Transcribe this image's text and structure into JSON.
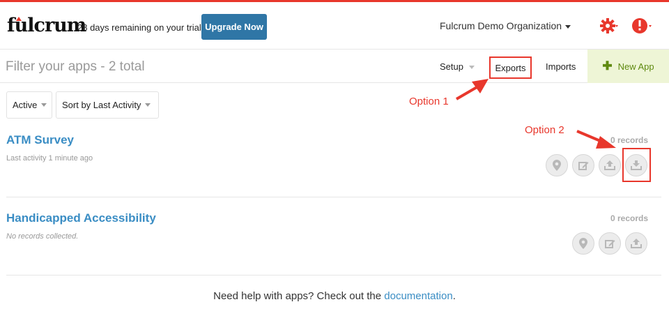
{
  "header": {
    "logo_text": "fulcrum",
    "trial_text": "28 days remaining on your trial",
    "upgrade_label": "Upgrade Now",
    "organization": "Fulcrum Demo Organization",
    "icons": {
      "settings": "gear-icon",
      "info": "info-icon"
    },
    "accent_color": "#e8372c",
    "button_color": "#2f76a6"
  },
  "filterbar": {
    "placeholder": "Filter your apps - 2 total",
    "setup_label": "Setup",
    "exports_label": "Exports",
    "imports_label": "Imports",
    "new_app_label": "New App"
  },
  "filters": {
    "status_selected": "Active",
    "sort_selected": "Sort by Last Activity"
  },
  "annotations": {
    "option1": "Option 1",
    "option2": "Option 2"
  },
  "apps": [
    {
      "name": "ATM Survey",
      "subtitle": "Last activity 1 minute ago",
      "records": "0 records",
      "actions": [
        "map-pin-icon",
        "edit-icon",
        "upload-icon",
        "download-icon"
      ]
    },
    {
      "name": "Handicapped Accessibility",
      "subtitle": "No records collected.",
      "records": "0 records",
      "actions": [
        "map-pin-icon",
        "edit-icon",
        "upload-icon"
      ]
    }
  ],
  "footer": {
    "text": "Need help with apps? Check out the ",
    "link": "documentation",
    "end": "."
  }
}
